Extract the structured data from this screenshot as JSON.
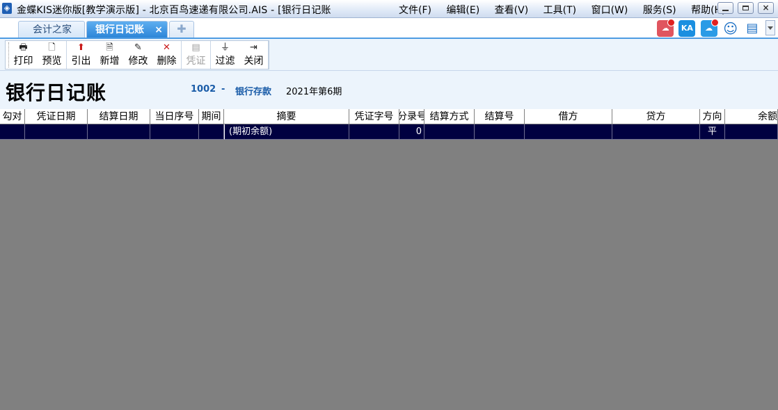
{
  "window": {
    "title": "金蝶KIS迷你版[教学演示版] - 北京百鸟速递有限公司.AIS - [银行日记账",
    "icon": "app-logo-icon",
    "controls": {
      "close_glyph": "×"
    }
  },
  "menu": [
    "文件(F)",
    "编辑(E)",
    "查看(V)",
    "工具(T)",
    "窗口(W)",
    "服务(S)",
    "帮助(H)"
  ],
  "tabs": [
    {
      "label": "会计之家",
      "active": false
    },
    {
      "label": "银行日记账",
      "active": true,
      "close_glyph": "×"
    }
  ],
  "tab_add_glyph": "✚",
  "tray": {
    "ka_label": "KA"
  },
  "toolbar": [
    {
      "id": "print",
      "label": "打印",
      "icon": "printer-icon",
      "enabled": true
    },
    {
      "id": "preview",
      "label": "预览",
      "icon": "preview-icon",
      "enabled": true
    },
    {
      "id": "export",
      "label": "引出",
      "icon": "export-icon",
      "enabled": true
    },
    {
      "id": "add",
      "label": "新增",
      "icon": "add-icon",
      "enabled": true
    },
    {
      "id": "edit",
      "label": "修改",
      "icon": "edit-icon",
      "enabled": true
    },
    {
      "id": "delete",
      "label": "删除",
      "icon": "delete-icon",
      "enabled": true
    },
    {
      "id": "voucher",
      "label": "凭证",
      "icon": "voucher-icon",
      "enabled": false
    },
    {
      "id": "filter",
      "label": "过滤",
      "icon": "filter-icon",
      "enabled": true
    },
    {
      "id": "close",
      "label": "关闭",
      "icon": "exit-icon",
      "enabled": true
    }
  ],
  "report": {
    "title": "银行日记账",
    "account_code": "1002",
    "separator": "-",
    "account_name": "银行存款",
    "period": "2021年第6期"
  },
  "grid": {
    "columns": [
      "勾对",
      "凭证日期",
      "结算日期",
      "当日序号",
      "期间",
      "摘要",
      "凭证字号",
      "分录号",
      "结算方式",
      "结算号",
      "借方",
      "贷方",
      "方向",
      "余额"
    ],
    "rows": [
      {
        "check": "",
        "voucher_date": "",
        "settle_date": "",
        "seq": "",
        "period": "",
        "summary": "(期初余额)",
        "voucher_no": "",
        "entry_no": "0",
        "settle_method": "",
        "settle_no": "",
        "debit": "",
        "credit": "",
        "direction": "平",
        "balance": ""
      }
    ]
  },
  "colors": {
    "selected_row": "#000040",
    "accent": "#2d86d8",
    "workspace": "#808080"
  }
}
